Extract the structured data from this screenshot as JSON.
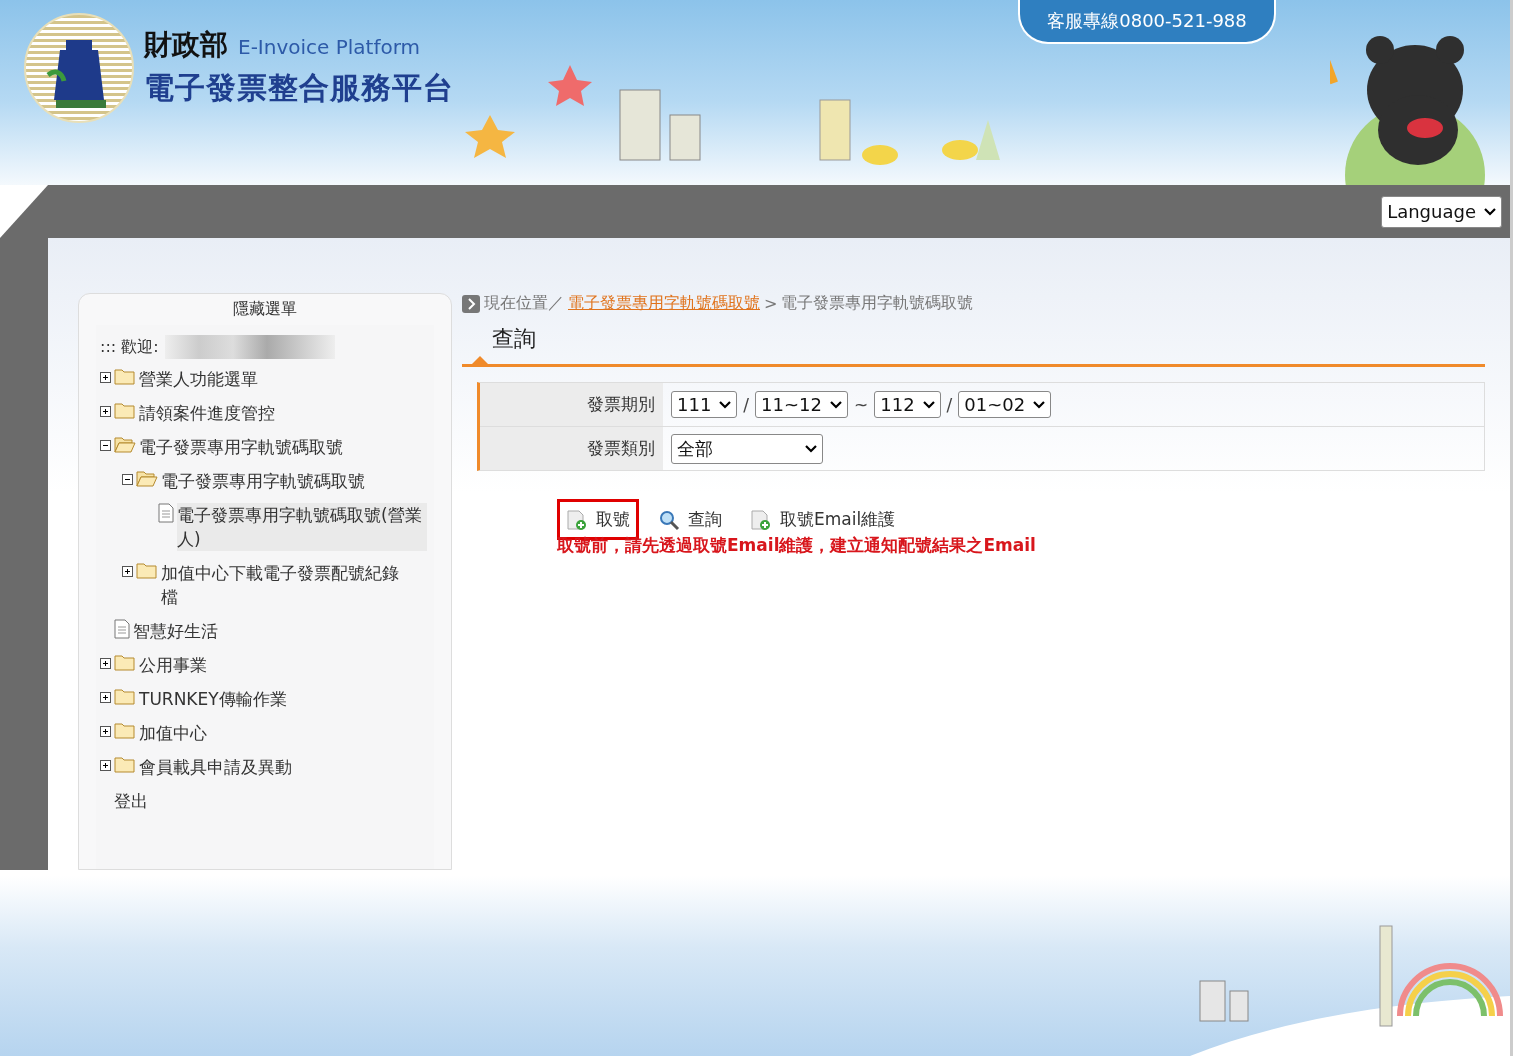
{
  "header": {
    "ministry": "財政部",
    "english_name": "E-Invoice Platform",
    "platform_name": "電子發票整合服務平台",
    "hotline": "客服專線0800-521-988"
  },
  "language_select": {
    "value": "Language"
  },
  "sidebar": {
    "title": "隱藏選單",
    "welcome_label": "::: 歡迎:",
    "tree": [
      {
        "label": "營業人功能選單",
        "kind": "folder",
        "expanded": false
      },
      {
        "label": "請領案件進度管控",
        "kind": "folder",
        "expanded": false
      },
      {
        "label": "電子發票專用字軌號碼取號",
        "kind": "folder",
        "expanded": true,
        "children": [
          {
            "label": "電子發票專用字軌號碼取號",
            "kind": "folder",
            "expanded": true,
            "children": [
              {
                "label": "電子發票專用字軌號碼取號(營業人)",
                "kind": "page",
                "selected": true
              }
            ]
          },
          {
            "label": "加值中心下載電子發票配號紀錄檔",
            "kind": "folder",
            "expanded": false
          }
        ]
      },
      {
        "label": "智慧好生活",
        "kind": "page",
        "selected": false
      },
      {
        "label": "公用事業",
        "kind": "folder",
        "expanded": false
      },
      {
        "label": "TURNKEY傳輸作業",
        "kind": "folder",
        "expanded": false
      },
      {
        "label": "加值中心",
        "kind": "folder",
        "expanded": false
      },
      {
        "label": "會員載具申請及異動",
        "kind": "folder",
        "expanded": false
      },
      {
        "label": "登出",
        "kind": "text"
      }
    ]
  },
  "breadcrumb": {
    "prefix": "現在位置／",
    "link": "電子發票專用字軌號碼取號",
    "separator": ">",
    "current": "電子發票專用字軌號碼取號"
  },
  "section_title": "查詢",
  "form": {
    "rows": [
      {
        "label": "發票期別",
        "kind": "period",
        "selects": [
          {
            "value": "111"
          },
          {
            "value": "11~12"
          },
          {
            "value": "112"
          },
          {
            "value": "01~02"
          }
        ],
        "separators": [
          "/",
          "~",
          "/"
        ]
      },
      {
        "label": "發票類別",
        "kind": "single",
        "selects": [
          {
            "value": "全部"
          }
        ]
      }
    ]
  },
  "actions": [
    {
      "label": "取號",
      "kind": "add",
      "highlighted": true
    },
    {
      "label": "查詢",
      "kind": "search",
      "highlighted": false
    },
    {
      "label": "取號Email維護",
      "kind": "add",
      "highlighted": false
    }
  ],
  "notice": "取號前，請先透過取號Email維護，建立通知配號結果之Email"
}
